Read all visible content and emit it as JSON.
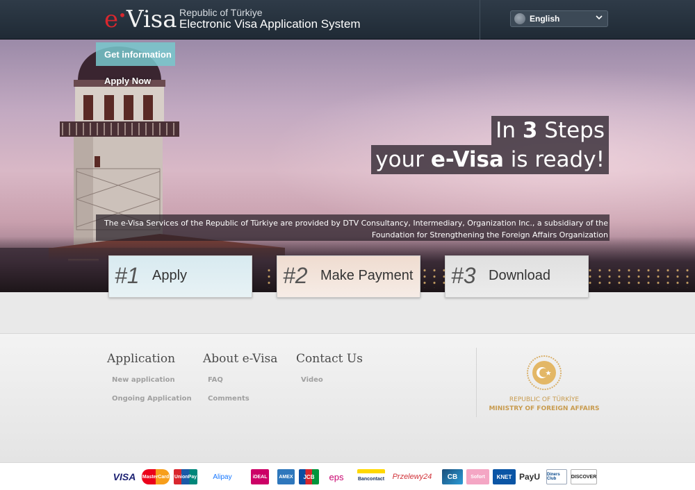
{
  "header": {
    "logo_e": "e",
    "logo_visa": "Visa",
    "subtitle": "Republic of Türkiye",
    "title": "Electronic Visa Application System",
    "language": "English"
  },
  "nav": {
    "get_information": "Get information",
    "apply_now": "Apply Now"
  },
  "hero": {
    "line1_pre": "In ",
    "line1_num": "3",
    "line1_post": " Steps",
    "line2_pre": "your ",
    "line2_brand": "e-Visa",
    "line2_post": " is ready!",
    "notice_line1": "The e-Visa Services of the Republic of Türkiye are provided by DTV Consultancy, Intermediary, Organization Inc., a subsidiary of the",
    "notice_line2": "Foundation for Strengthening the Foreign Affairs Organization"
  },
  "steps": [
    {
      "num": "#1",
      "label": "Apply"
    },
    {
      "num": "#2",
      "label": "Make Payment"
    },
    {
      "num": "#3",
      "label": "Download"
    }
  ],
  "footer": {
    "columns": [
      {
        "heading": "Application",
        "links": [
          "New application",
          "Ongoing Application"
        ]
      },
      {
        "heading": "About e-Visa",
        "links": [
          "FAQ",
          "Comments"
        ]
      },
      {
        "heading": "Contact Us",
        "links": [
          "Video"
        ]
      }
    ],
    "ministry_line1": "REPUBLIC OF TÜRKİYE",
    "ministry_line2": "MINISTRY OF FOREIGN AFFAIRS"
  },
  "payments": [
    "VISA",
    "MasterCard",
    "UnionPay",
    "Alipay",
    "iDEAL",
    "AMEX",
    "JCB",
    "eps",
    "Bancontact",
    "Przelewy24",
    "CB",
    "Sofort",
    "KNET",
    "PayU",
    "Diners Club",
    "DISCOVER"
  ],
  "colors": {
    "header_bg": "#2f3b48",
    "logo_red": "#d9272e",
    "ministry_gold": "#c89b4e",
    "get_info_teal": "#78c8cd"
  }
}
